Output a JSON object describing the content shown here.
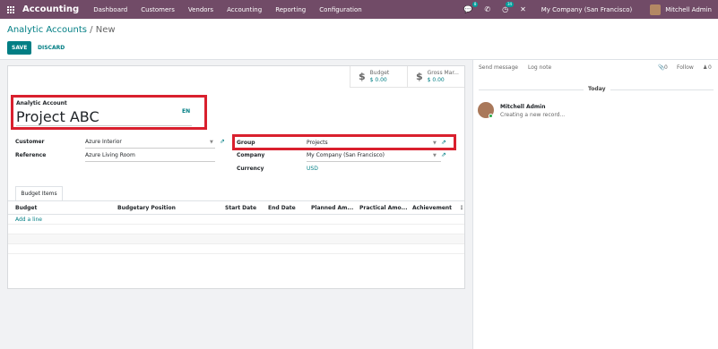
{
  "navbar": {
    "apps_icon": "grid-icon",
    "brand": "Accounting",
    "menu": [
      "Dashboard",
      "Customers",
      "Vendors",
      "Accounting",
      "Reporting",
      "Configuration"
    ],
    "messages_icon": "chat-icon",
    "messages_count": "8",
    "phone_icon": "phone-icon",
    "activity_icon": "clock-icon",
    "activity_count": "34",
    "close_icon": "close-icon",
    "company": "My Company (San Francisco)",
    "user": "Mitchell Admin"
  },
  "breadcrumb": {
    "parent": "Analytic Accounts",
    "separator": "/",
    "current": "New"
  },
  "actions": {
    "save": "SAVE",
    "discard": "DISCARD"
  },
  "smart_buttons": [
    {
      "label": "Budget",
      "value": "$ 0.00",
      "icon": "dollar-icon"
    },
    {
      "label": "Gross Mar...",
      "value": "$ 0.00",
      "icon": "dollar-icon"
    }
  ],
  "form": {
    "name_label": "Analytic Account",
    "name_value": "Project ABC",
    "language": "EN",
    "customer_label": "Customer",
    "customer_value": "Azure Interior",
    "reference_label": "Reference",
    "reference_value": "Azure Living Room",
    "group_label": "Group",
    "group_value": "Projects",
    "company_label": "Company",
    "company_value": "My Company (San Francisco)",
    "currency_label": "Currency",
    "currency_value": "USD"
  },
  "tab": "Budget Items",
  "table": {
    "columns": [
      "Budget",
      "Budgetary Position",
      "Start Date",
      "End Date",
      "Planned Am...",
      "Practical Amo...",
      "Achievement"
    ],
    "add_line": "Add a line",
    "options_icon": "kebab-icon"
  },
  "chatter": {
    "send_message": "Send message",
    "log_note": "Log note",
    "attachments": "0",
    "follow": "Follow",
    "followers": "0",
    "today": "Today",
    "author": "Mitchell Admin",
    "message": "Creating a new record..."
  },
  "colors": {
    "navbar": "#714b67",
    "accent": "#017e84",
    "highlight": "#d9202e"
  }
}
